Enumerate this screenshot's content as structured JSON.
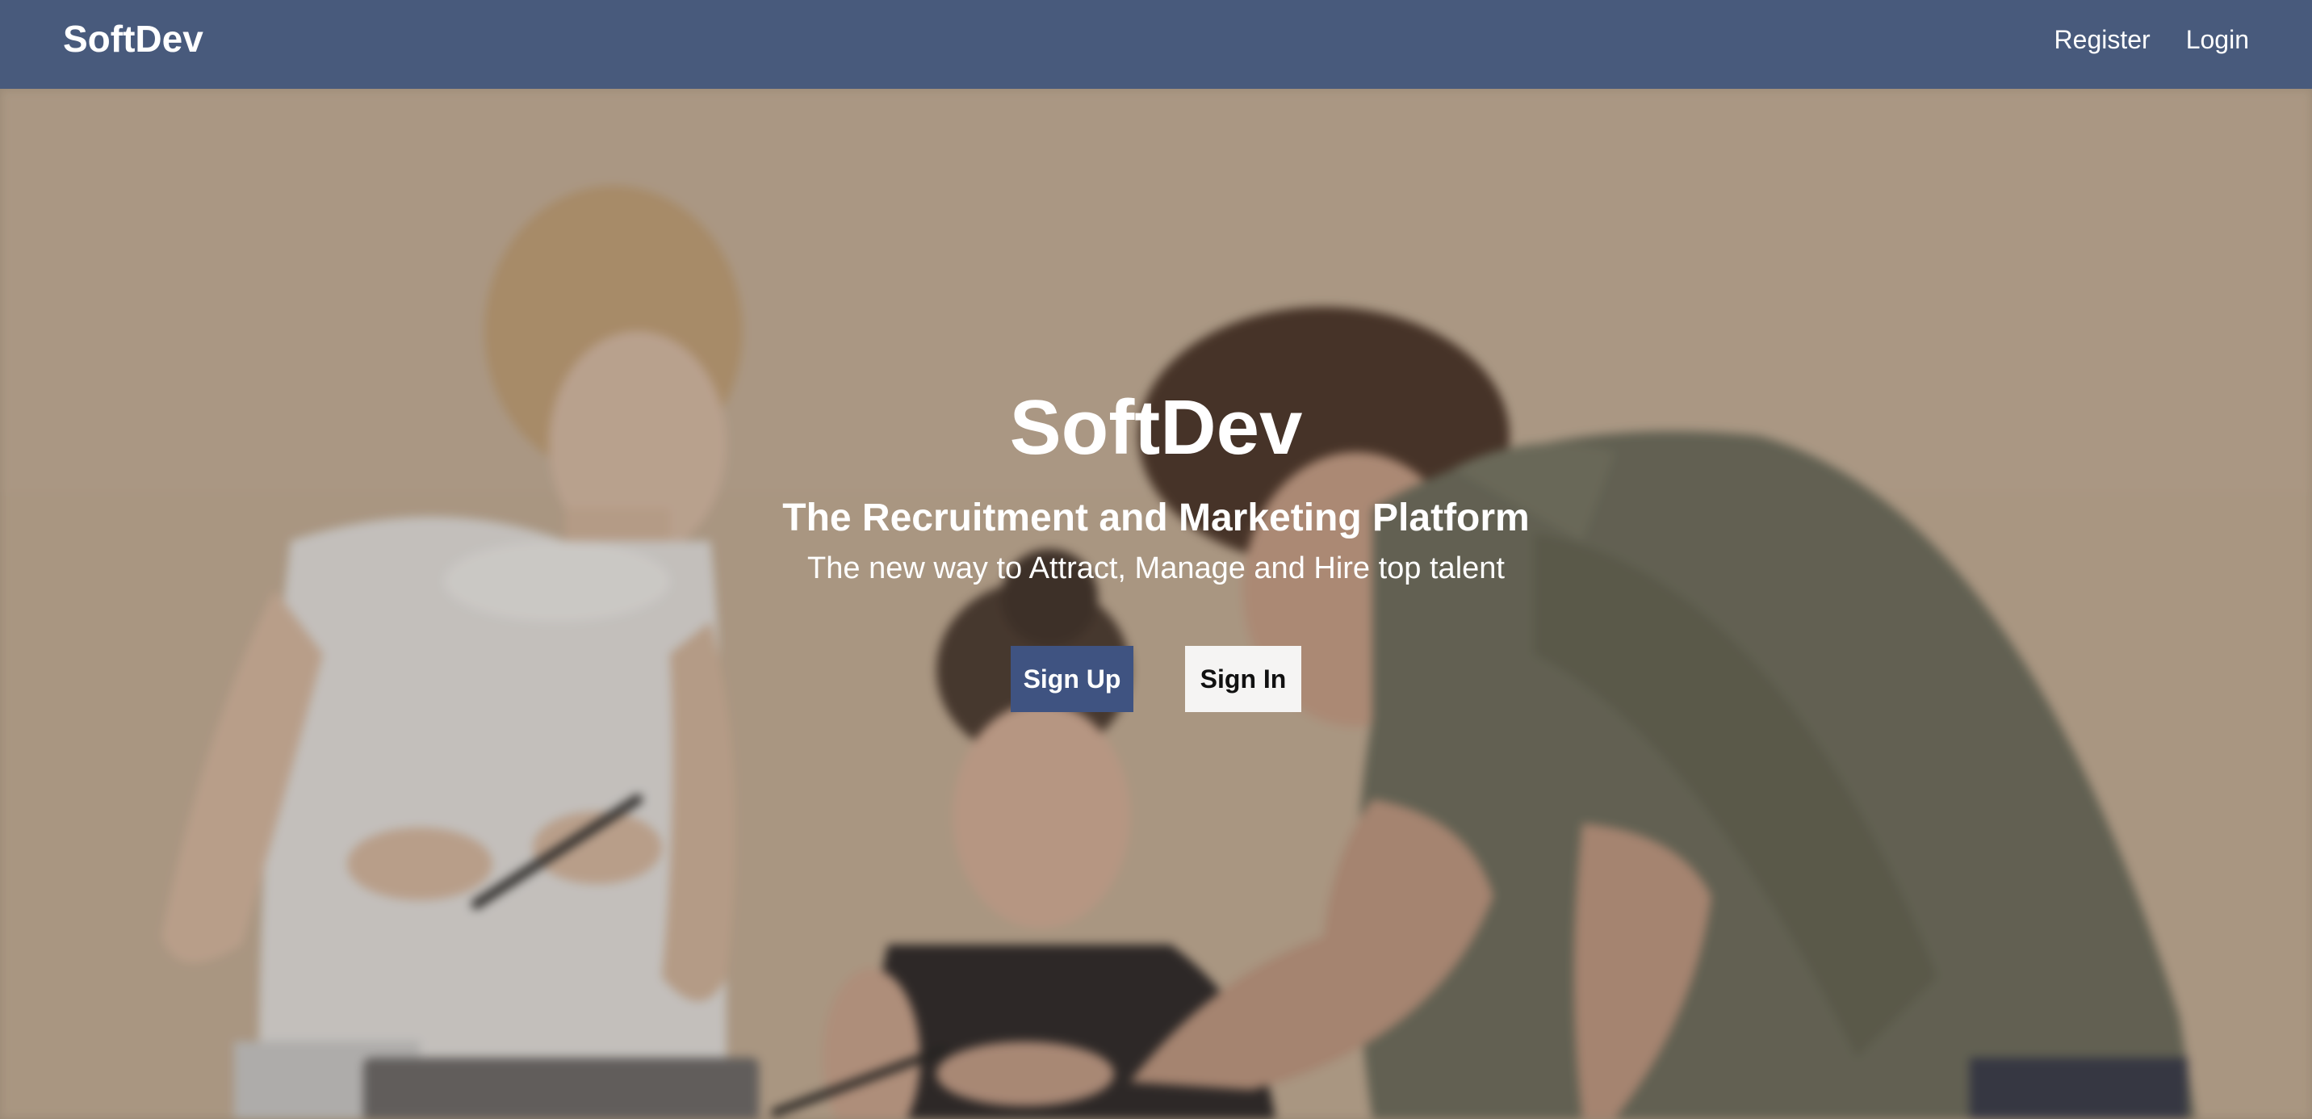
{
  "navbar": {
    "brand": "SoftDev",
    "links": [
      "Register",
      "Login"
    ]
  },
  "hero": {
    "title": "SoftDev",
    "subtitle": "The Recruitment and Marketing Platform",
    "tagline": "The new way to Attract, Manage and Hire top talent",
    "primary_button": "Sign Up",
    "secondary_button": "Sign In"
  },
  "colors": {
    "navbar": "#485a7c",
    "primary_button": "#3f5381",
    "secondary_button": "#f5f4f3",
    "text": "#ffffff"
  }
}
